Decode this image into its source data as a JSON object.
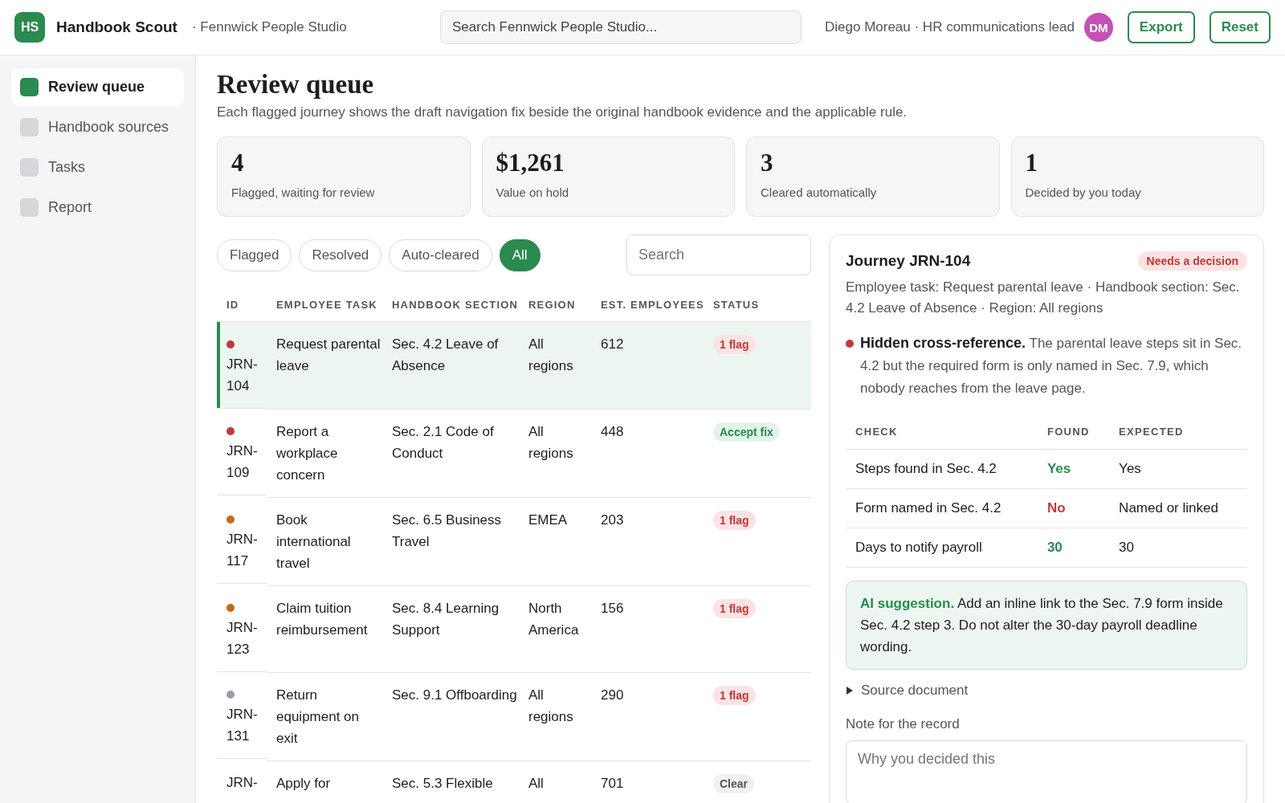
{
  "app": {
    "logo": "HS",
    "name": "Handbook Scout",
    "workspace": "· Fennwick People Studio"
  },
  "search": {
    "placeholder": "Search Fennwick People Studio..."
  },
  "user": {
    "label": "Diego Moreau · HR communications lead",
    "initials": "DM"
  },
  "header_buttons": [
    "Export",
    "Reset"
  ],
  "sidebar": {
    "items": [
      {
        "label": "Review queue",
        "selected": true
      },
      {
        "label": "Handbook sources",
        "selected": false
      },
      {
        "label": "Tasks",
        "selected": false
      },
      {
        "label": "Report",
        "selected": false
      }
    ]
  },
  "page": {
    "title": "Review queue",
    "subtitle": "Each flagged journey shows the draft navigation fix beside the original handbook evidence and the applicable rule."
  },
  "stats": [
    {
      "value": "4",
      "label": "Flagged, waiting for review"
    },
    {
      "value": "$1,261",
      "label": "Value on hold"
    },
    {
      "value": "3",
      "label": "Cleared automatically"
    },
    {
      "value": "1",
      "label": "Decided by you today"
    }
  ],
  "filters": [
    {
      "label": "Flagged",
      "selected": false
    },
    {
      "label": "Resolved",
      "selected": false
    },
    {
      "label": "Auto-cleared",
      "selected": false
    },
    {
      "label": "All",
      "selected": true
    }
  ],
  "table_search": {
    "placeholder": "Search"
  },
  "table": {
    "columns": [
      "ID",
      "EMPLOYEE TASK",
      "HANDBOOK SECTION",
      "REGION",
      "EST. EMPLOYEES",
      "STATUS"
    ],
    "rows": [
      {
        "id": "JRN-104",
        "task": "Request parental leave",
        "section": "Sec. 4.2 Leave of Absence",
        "region": "All regions",
        "employees": "612",
        "status": {
          "label": "1 flag",
          "kind": "flag"
        },
        "color": "#c0393b",
        "selected": true
      },
      {
        "id": "JRN-109",
        "task": "Report a workplace concern",
        "section": "Sec. 2.1 Code of Conduct",
        "region": "All regions",
        "employees": "448",
        "status": {
          "label": "Accept fix",
          "kind": "accept"
        },
        "color": "#c0393b",
        "selected": false
      },
      {
        "id": "JRN-117",
        "task": "Book international travel",
        "section": "Sec. 6.5 Business Travel",
        "region": "EMEA",
        "employees": "203",
        "status": {
          "label": "1 flag",
          "kind": "flag"
        },
        "color": "#c46a1a",
        "selected": false
      },
      {
        "id": "JRN-123",
        "task": "Claim tuition reimbursement",
        "section": "Sec. 8.4 Learning Support",
        "region": "North America",
        "employees": "156",
        "status": {
          "label": "1 flag",
          "kind": "flag"
        },
        "color": "#c46a1a",
        "selected": false
      },
      {
        "id": "JRN-131",
        "task": "Return equipment on exit",
        "section": "Sec. 9.1 Offboarding",
        "region": "All regions",
        "employees": "290",
        "status": {
          "label": "1 flag",
          "kind": "flag"
        },
        "color": "#9a9aa8",
        "selected": false
      },
      {
        "id": "JRN-",
        "task": "Apply for",
        "section": "Sec. 5.3 Flexible",
        "region": "All",
        "employees": "701",
        "status": {
          "label": "Clear",
          "kind": "clear"
        },
        "selected": false
      }
    ]
  },
  "detail": {
    "title": "Journey JRN-104",
    "badge": "Needs a decision",
    "meta": "Employee task: Request parental leave · Handbook section: Sec. 4.2 Leave of Absence · Region: All regions",
    "finding": "**Hidden cross-reference.** The parental leave steps sit in Sec. 4.2 but the required form is only named in Sec. 7.9, which nobody reaches from the leave page.",
    "checks": {
      "columns": [
        "CHECK",
        "FOUND",
        "EXPECTED"
      ],
      "rows": [
        {
          "check": "Steps found in Sec. 4.2",
          "found": "Yes",
          "found_ok": true,
          "expected": "Yes"
        },
        {
          "check": "Form named in Sec. 4.2",
          "found": "No",
          "found_ok": false,
          "expected": "Named or linked"
        },
        {
          "check": "Days to notify payroll",
          "found": "30",
          "found_ok": true,
          "expected": "30"
        }
      ]
    },
    "suggestion": "**AI suggestion.** Add an inline link to the Sec. 7.9 form inside Sec. 4.2 step 3. Do not alter the 30-day payroll deadline wording.",
    "source": {
      "label": "Source document",
      "expanded": false
    },
    "note": {
      "label": "Note for the record",
      "placeholder": "Why you decided this"
    }
  }
}
